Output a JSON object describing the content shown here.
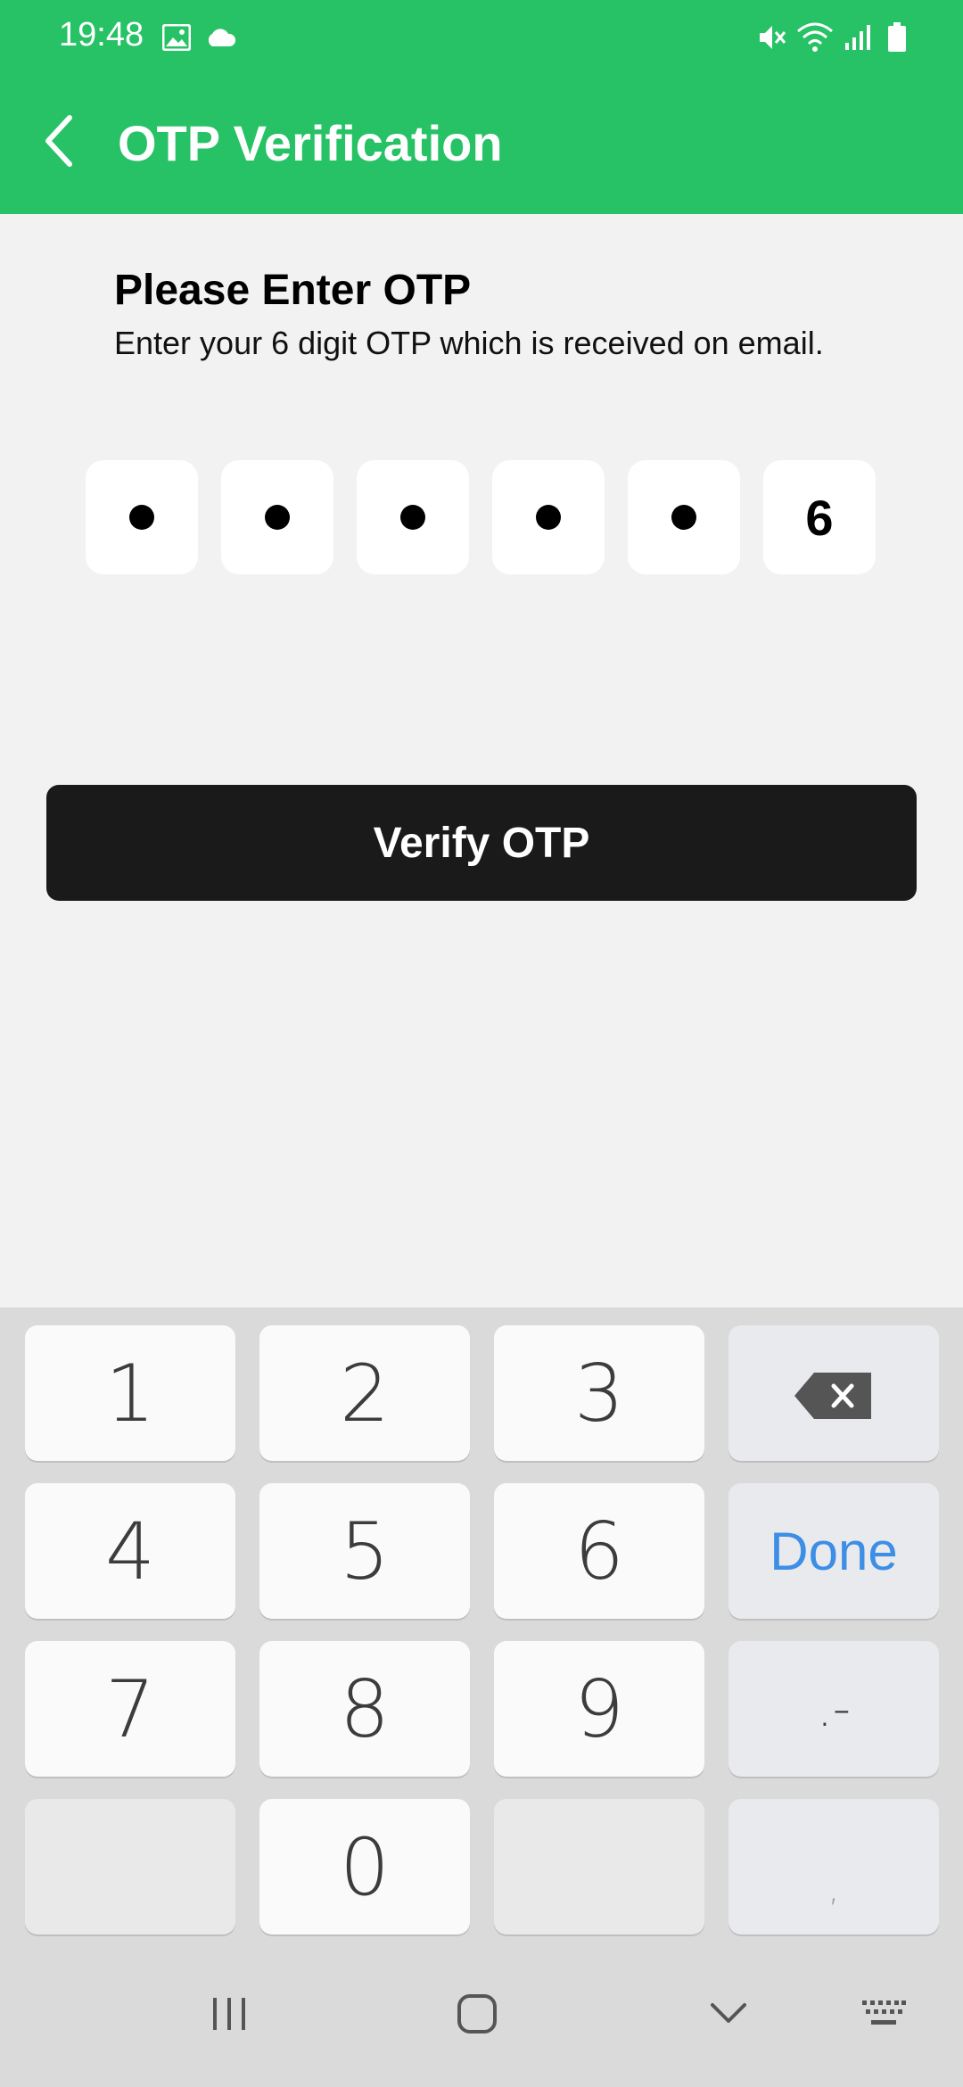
{
  "status_bar": {
    "time": "19:48",
    "icons": [
      "image-icon",
      "cloud-icon",
      "mute-icon",
      "wifi-icon",
      "signal-icon",
      "battery-icon"
    ]
  },
  "app_bar": {
    "title": "OTP Verification",
    "back_icon": "chevron-left-icon"
  },
  "content": {
    "heading": "Please Enter OTP",
    "subtext": "Enter your 6 digit OTP which is received on email.",
    "otp": {
      "length": 6,
      "masked_count": 5,
      "last_digit": "6"
    },
    "verify_button": "Verify OTP"
  },
  "keyboard": {
    "rows": [
      [
        "1",
        "2",
        "3",
        "backspace"
      ],
      [
        "4",
        "5",
        "6",
        "Done"
      ],
      [
        "7",
        "8",
        "9",
        ".-"
      ],
      [
        "",
        "0",
        "",
        ","
      ]
    ],
    "done_color": "#3d8ee5"
  },
  "nav_bar": {
    "icons": [
      "recents-icon",
      "home-icon",
      "hide-keyboard-icon",
      "keyboard-switch-icon"
    ]
  },
  "colors": {
    "primary": "#26c265",
    "button": "#1a1a1a",
    "background": "#f2f2f2"
  }
}
